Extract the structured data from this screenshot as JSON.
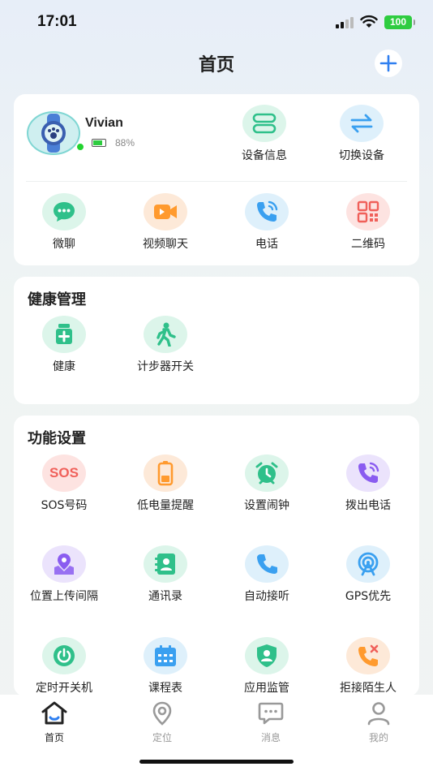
{
  "status_bar": {
    "time": "17:01",
    "battery": "100"
  },
  "header": {
    "title": "首页"
  },
  "device": {
    "name": "Vivian",
    "battery_text": "88%",
    "battery_level": 0.88,
    "actions": [
      {
        "label": "设备信息",
        "icon": "device-info-icon"
      },
      {
        "label": "切换设备",
        "icon": "switch-arrows-icon"
      }
    ]
  },
  "quick_actions": [
    {
      "label": "微聊",
      "icon": "chat-bubble-icon"
    },
    {
      "label": "视频聊天",
      "icon": "video-camera-icon"
    },
    {
      "label": "电话",
      "icon": "phone-icon"
    },
    {
      "label": "二维码",
      "icon": "qr-code-icon"
    }
  ],
  "health": {
    "title": "健康管理",
    "items": [
      {
        "label": "健康",
        "icon": "medical-kit-icon"
      },
      {
        "label": "计步器开关",
        "icon": "walking-person-icon"
      }
    ]
  },
  "functions": {
    "title": "功能设置",
    "items": [
      {
        "label": "SOS号码",
        "icon": "sos-icon",
        "text": "SOS"
      },
      {
        "label": "低电量提醒",
        "icon": "low-battery-icon"
      },
      {
        "label": "设置闹钟",
        "icon": "alarm-clock-icon"
      },
      {
        "label": "拨出电话",
        "icon": "outgoing-call-icon"
      },
      {
        "label": "位置上传间隔",
        "icon": "location-upload-icon"
      },
      {
        "label": "通讯录",
        "icon": "contacts-icon"
      },
      {
        "label": "自动接听",
        "icon": "auto-answer-icon"
      },
      {
        "label": "GPS优先",
        "icon": "gps-icon"
      },
      {
        "label": "定时开关机",
        "icon": "power-timer-icon"
      },
      {
        "label": "课程表",
        "icon": "calendar-icon"
      },
      {
        "label": "应用监管",
        "icon": "shield-user-icon"
      },
      {
        "label": "拒接陌生人",
        "icon": "reject-call-icon"
      }
    ]
  },
  "tabbar": {
    "tabs": [
      {
        "label": "首页",
        "icon": "home-icon",
        "active": true
      },
      {
        "label": "定位",
        "icon": "location-pin-icon",
        "active": false
      },
      {
        "label": "消息",
        "icon": "message-icon",
        "active": false
      },
      {
        "label": "我的",
        "icon": "profile-icon",
        "active": false
      }
    ]
  },
  "colors": {
    "green": "#2fc08a",
    "orange": "#ff9a2e",
    "blue": "#3aa0f0",
    "purple": "#8a5cf0",
    "red": "#f0605a",
    "active_tab": "#222222",
    "inactive_tab": "#999999"
  }
}
